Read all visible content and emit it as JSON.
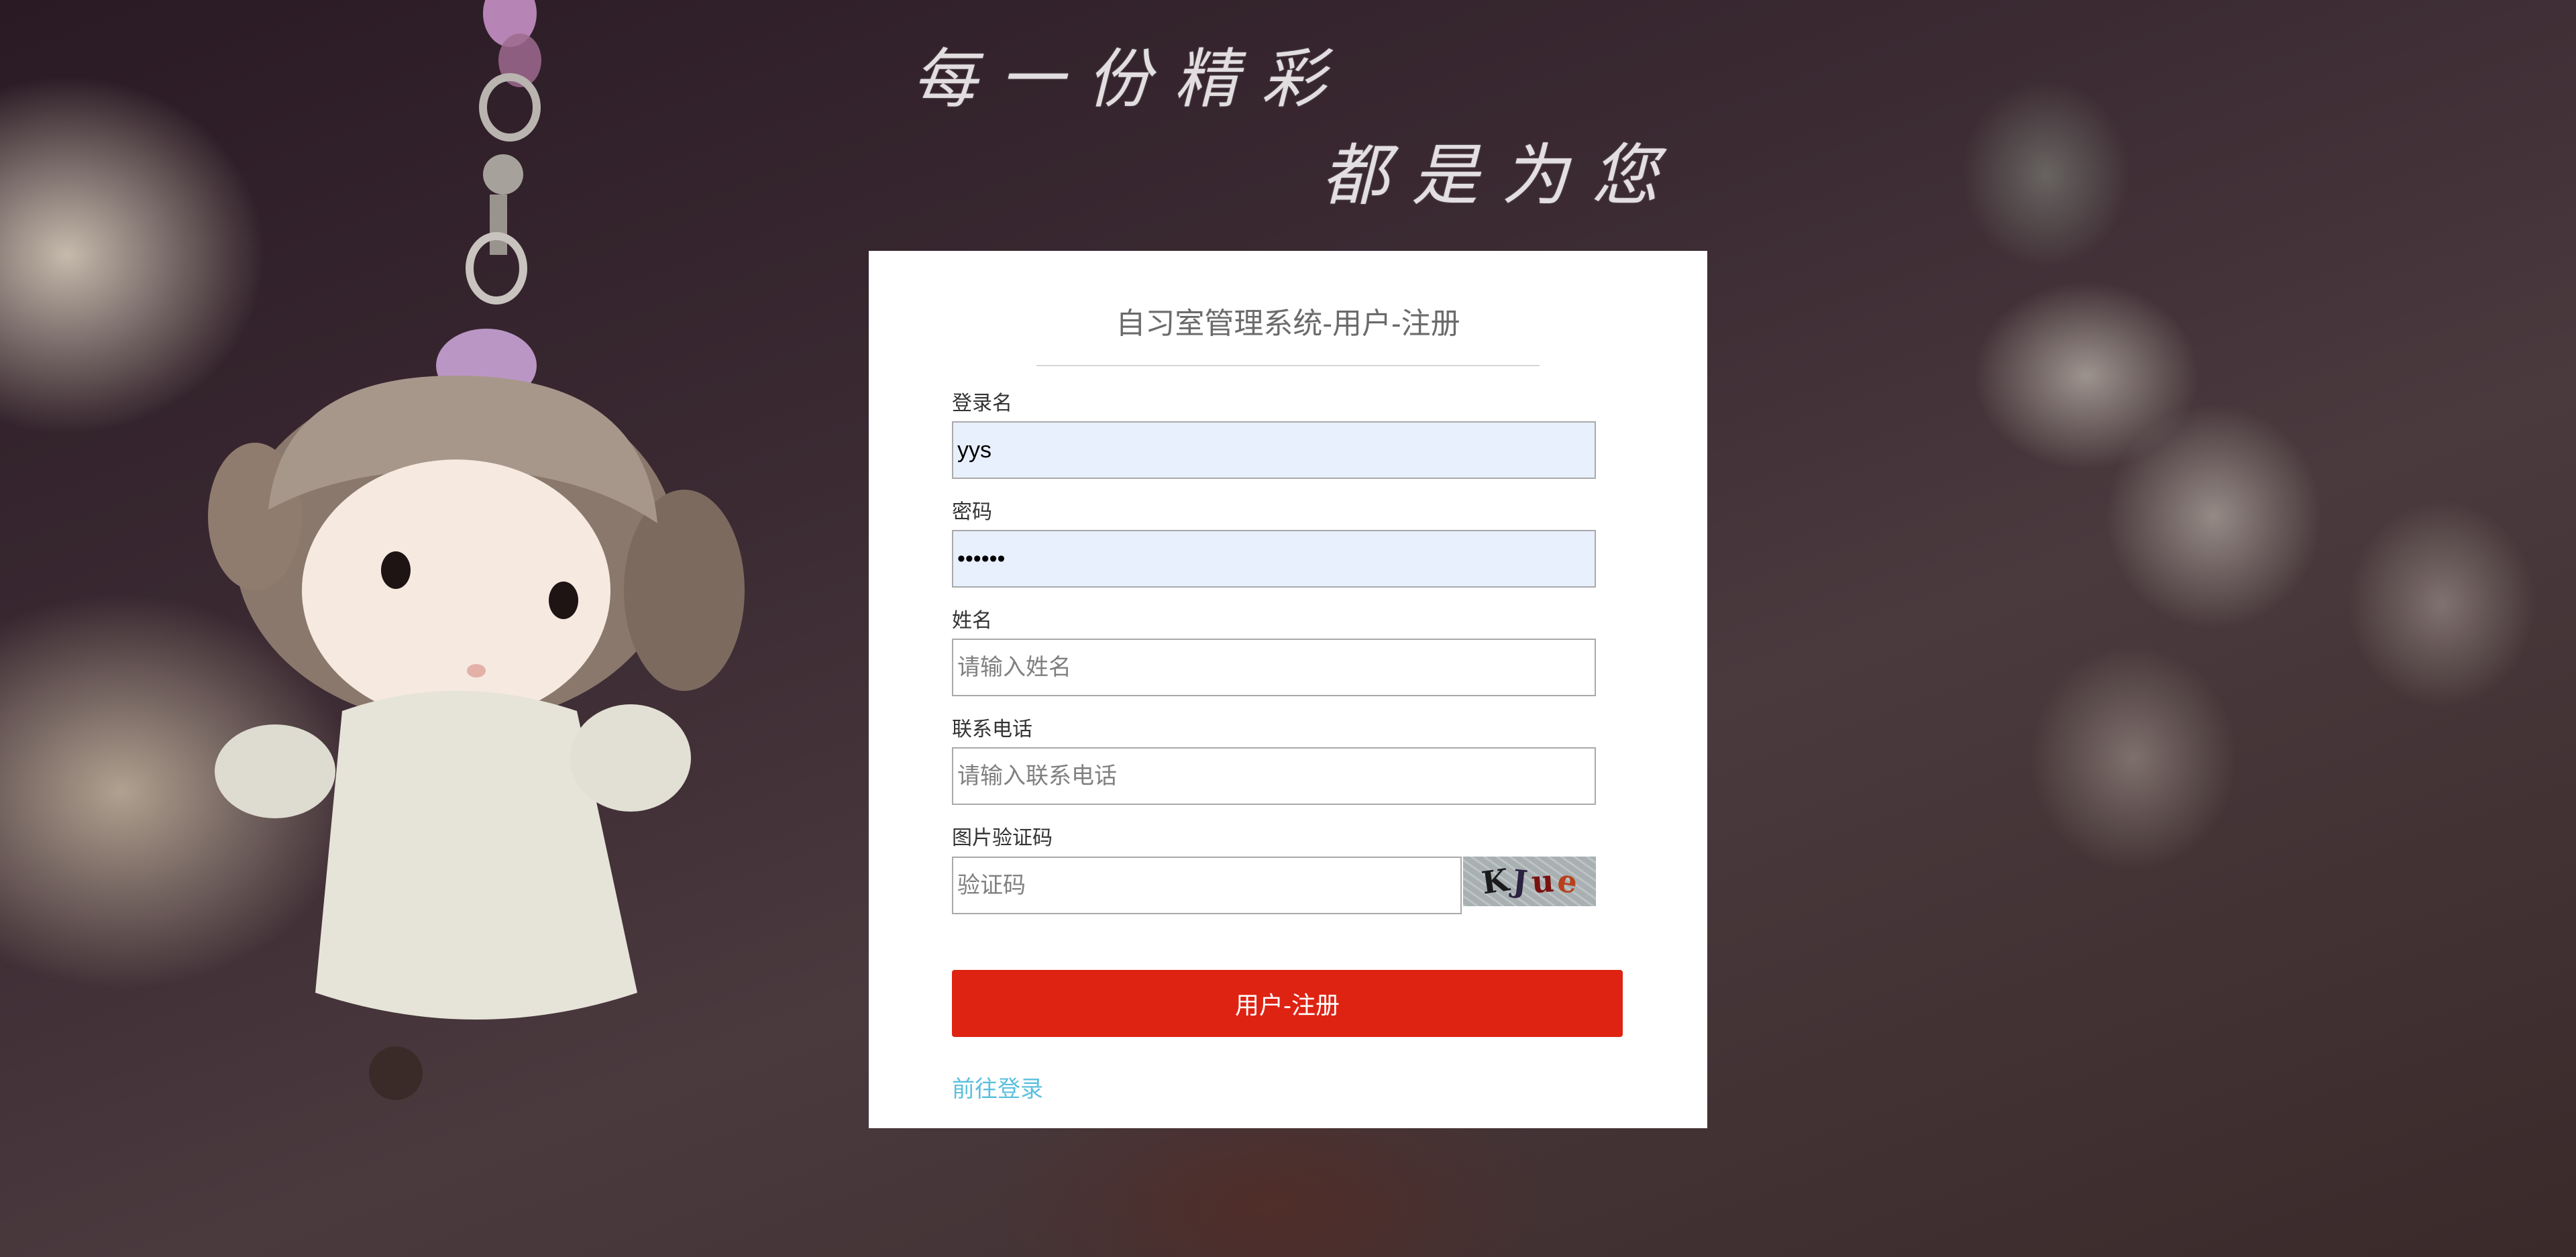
{
  "background": {
    "slogan_line_1": "每一份精彩",
    "slogan_line_2": "都是为您"
  },
  "form": {
    "title": "自习室管理系统-用户-注册",
    "fields": [
      {
        "label": "登录名",
        "value": "yys",
        "placeholder": ""
      },
      {
        "label": "密码",
        "value": "••••••",
        "placeholder": ""
      },
      {
        "label": "姓名",
        "value": "",
        "placeholder": "请输入姓名"
      },
      {
        "label": "联系电话",
        "value": "",
        "placeholder": "请输入联系电话"
      },
      {
        "label": "图片验证码",
        "value": "",
        "placeholder": "验证码"
      }
    ],
    "captcha": {
      "characters": [
        "K",
        "J",
        "u",
        "e"
      ],
      "colors": [
        "#1b1b1b",
        "#2b2240",
        "#7a1212",
        "#b8401a"
      ]
    },
    "submit_label": "用户-注册",
    "login_link": "前往登录"
  },
  "colors": {
    "submit_bg": "#de2313",
    "link": "#5bc0de",
    "autofill_bg": "#e8f0fe"
  }
}
